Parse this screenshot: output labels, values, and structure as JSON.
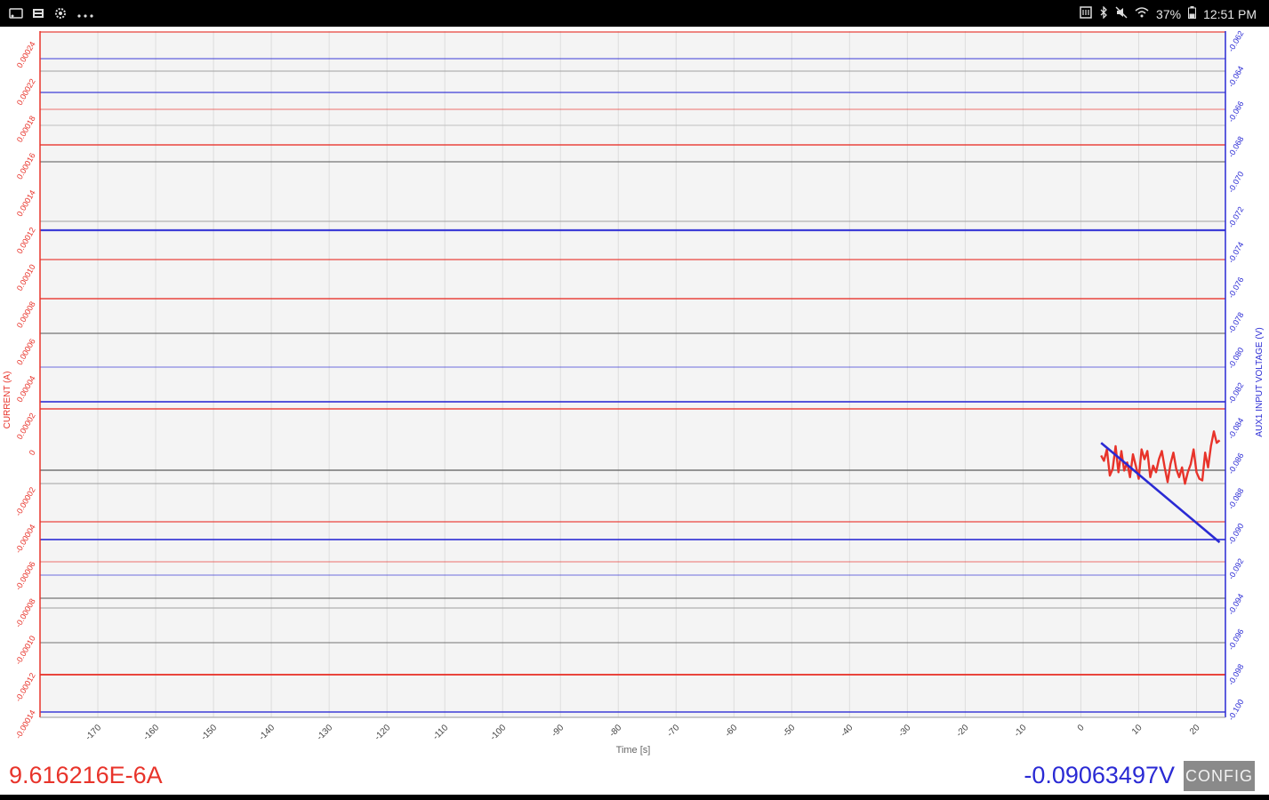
{
  "status_bar": {
    "left_icons": [
      "cast-icon",
      "gallery-icon",
      "settings-icon",
      "more-icon"
    ],
    "right_icons": [
      "nfc-icon",
      "bluetooth-icon",
      "mute-icon",
      "wifi-icon"
    ],
    "battery": "37%",
    "time": "12:51 PM"
  },
  "chart": {
    "xlabel": "Time [s]",
    "left_axis_label": "CURRENT (A)",
    "right_axis_label": "AUX1 INPUT VOLTAGE (V)",
    "colors": {
      "current": "#e8332a",
      "voltage": "#2a2ad4",
      "grid": "#dddddd",
      "plot_bg": "#f4f4f4"
    },
    "right_tick_labels": [
      "-0.062",
      "-0.064",
      "-0.066",
      "-0.068",
      "-0.070",
      "-0.072",
      "-0.074",
      "-0.076",
      "-0.078",
      "-0.080",
      "-0.082",
      "-0.084",
      "-0.086",
      "-0.088",
      "-0.090",
      "-0.092",
      "-0.094",
      "-0.096",
      "-0.098",
      "-0.100"
    ],
    "left_tick_labels": [
      "0.00024",
      "0.00022",
      "0.00018",
      "0.00016",
      "0.00014",
      "0.00012",
      "0.00010",
      "0.00008",
      "0.00006",
      "0.00004",
      "0.00002",
      "0",
      "-0.00002",
      "-0.00004",
      "-0.00006",
      "-0.00008",
      "-0.00010",
      "-0.00012",
      "-0.00014"
    ]
  },
  "chart_data": {
    "type": "line",
    "xlabel": "Time [s]",
    "xlim": [
      -180,
      25
    ],
    "x_ticks": [
      -170,
      -160,
      -150,
      -140,
      -130,
      -120,
      -110,
      -100,
      -90,
      -80,
      -70,
      -60,
      -50,
      -40,
      -30,
      -20,
      -10,
      0,
      10,
      20
    ],
    "y_left": {
      "label": "CURRENT (A)",
      "ylim": [
        -0.00016,
        0.00026
      ]
    },
    "y_right": {
      "label": "AUX1 INPUT VOLTAGE (V)",
      "ylim": [
        -0.1008,
        -0.0608
      ]
    },
    "series": [
      {
        "name": "CURRENT (A)",
        "axis": "left",
        "color": "#e8332a",
        "x": [
          3.5,
          4,
          4.5,
          5,
          5.5,
          6,
          6.5,
          7,
          7.5,
          8,
          8.5,
          9,
          9.5,
          10,
          10.5,
          11,
          11.5,
          12,
          12.5,
          13,
          13.5,
          14,
          14.5,
          15,
          15.5,
          16,
          16.5,
          17,
          17.5,
          18,
          18.5,
          19,
          19.5,
          20,
          20.5,
          21,
          21.5,
          22,
          22.5,
          23,
          23.5,
          24
        ],
        "y": [
          3e-07,
          -3e-06,
          4e-06,
          -1.2e-05,
          -8e-06,
          6e-06,
          -1e-05,
          3e-06,
          -9e-06,
          -4e-06,
          -1.3e-05,
          1e-06,
          -6e-06,
          -1.4e-05,
          4e-06,
          -2e-06,
          3e-06,
          -1.3e-05,
          -6e-06,
          -1e-05,
          -2e-06,
          3e-06,
          -7e-06,
          -1.6e-05,
          -5e-06,
          2e-06,
          -8e-06,
          -1.3e-05,
          -7e-06,
          -1.7e-05,
          -1e-05,
          -5e-06,
          4e-06,
          -1e-05,
          -1.4e-05,
          -1.5e-05,
          2e-06,
          -7e-06,
          6e-06,
          1.5e-05,
          8e-06,
          9.6e-06
        ]
      },
      {
        "name": "AUX1 INPUT VOLTAGE (V)",
        "axis": "right",
        "color": "#2a2ad4",
        "x": [
          3.5,
          24
        ],
        "y": [
          -0.0848,
          -0.0906
        ]
      }
    ]
  },
  "readouts": {
    "current": "9.616216E-6A",
    "voltage": "-0.09063497V"
  },
  "config_button": {
    "label": "CONFIG"
  }
}
